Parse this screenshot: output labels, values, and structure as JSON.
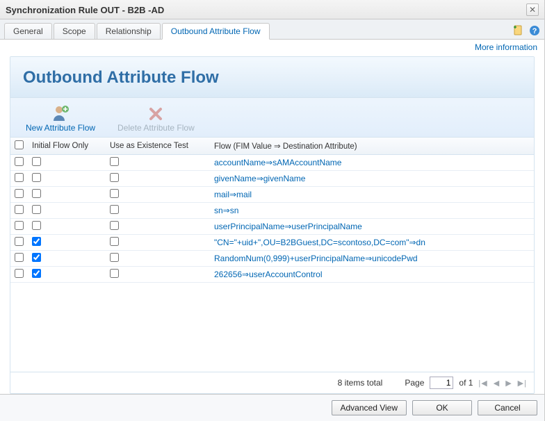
{
  "window": {
    "title": "Synchronization Rule OUT - B2B -AD"
  },
  "tabs": [
    {
      "label": "General"
    },
    {
      "label": "Scope"
    },
    {
      "label": "Relationship"
    },
    {
      "label": "Outbound Attribute Flow"
    }
  ],
  "active_tab_index": 3,
  "more_info_label": "More information",
  "panel_title": "Outbound Attribute Flow",
  "toolbar": {
    "new_label": "New Attribute Flow",
    "delete_label": "Delete Attribute Flow"
  },
  "columns": {
    "initial": "Initial Flow Only",
    "existence": "Use as Existence Test",
    "flow": "Flow (FIM Value ⇒ Destination Attribute)"
  },
  "rows": [
    {
      "initial": false,
      "existence": false,
      "flow": "accountName⇒sAMAccountName"
    },
    {
      "initial": false,
      "existence": false,
      "flow": "givenName⇒givenName"
    },
    {
      "initial": false,
      "existence": false,
      "flow": "mail⇒mail"
    },
    {
      "initial": false,
      "existence": false,
      "flow": "sn⇒sn"
    },
    {
      "initial": false,
      "existence": false,
      "flow": "userPrincipalName⇒userPrincipalName"
    },
    {
      "initial": true,
      "existence": false,
      "flow": "\"CN=\"+uid+\",OU=B2BGuest,DC=scontoso,DC=com\"⇒dn"
    },
    {
      "initial": true,
      "existence": false,
      "flow": "RandomNum(0,999)+userPrincipalName⇒unicodePwd"
    },
    {
      "initial": true,
      "existence": false,
      "flow": "262656⇒userAccountControl"
    }
  ],
  "pager": {
    "total_label": "8 items total",
    "page_label": "Page",
    "page_value": "1",
    "of_label": "of 1"
  },
  "footer": {
    "advanced": "Advanced View",
    "ok": "OK",
    "cancel": "Cancel"
  },
  "icons": {
    "new_paste": "new-item-icon",
    "help": "help-icon"
  }
}
